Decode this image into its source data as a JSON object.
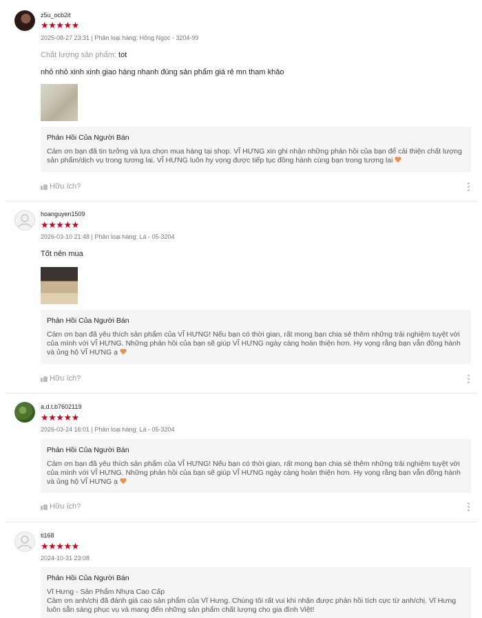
{
  "reviews": [
    {
      "username": "z5u_ocb2it",
      "stars": "★★★★★",
      "meta": "2025-08-27 23:31 | Phân loại hàng: Hồng Ngọc - 3204-99",
      "quality_label": "Chất lượng sản phẩm:",
      "quality_value": "tot",
      "comment": "nhỏ nhỏ xinh xinh giao hàng nhanh đúng sản phẩm giá rẻ mn tham khảo",
      "reply_title": "Phản Hồi Của Người Bán",
      "reply_text": "Cảm ơn bạn đã tin tưởng và lựa chọn mua hàng tại shop. VĨ HƯNG xin ghi nhận những phản hồi của bạn để cải thiện chất lượng sản phẩm/dịch vụ trong tương lai. VĨ HƯNG luôn hy vọng được tiếp tục đồng hành cùng bạn trong tương lai",
      "helpful": "Hữu ích?"
    },
    {
      "username": "hoanguyen1509",
      "stars": "★★★★★",
      "meta": "2026-03-10 21:48 | Phân loại hàng: Lá - 05-3204",
      "comment": "Tốt nên mua",
      "reply_title": "Phản Hồi Của Người Bán",
      "reply_text": "Cảm ơn bạn đã yêu thích sản phẩm của VĨ HƯNG! Nếu bạn có thời gian, rất mong bạn chia sẻ thêm những trải nghiệm tuyệt vời của mình với VĨ HƯNG. Những phản hồi của bạn sẽ giúp VĨ HƯNG ngày càng hoàn thiện hơn. Hy vọng rằng bạn vẫn đồng hành và ủng hộ VĨ HƯNG ạ",
      "helpful": "Hữu ích?"
    },
    {
      "username": "a.d.t.b7602119",
      "stars": "★★★★★",
      "meta": "2026-03-24 16:01 | Phân loại hàng: Lá - 05-3204",
      "reply_title": "Phản Hồi Của Người Bán",
      "reply_text": "Cảm ơn bạn đã yêu thích sản phẩm của VĨ HƯNG! Nếu bạn có thời gian, rất mong bạn chia sẻ thêm những trải nghiệm tuyệt vời của mình với VĨ HƯNG. Những phản hồi của bạn sẽ giúp VĨ HƯNG ngày càng hoàn thiện hơn. Hy vọng rằng bạn vẫn đồng hành và ủng hộ VĨ HƯNG ạ",
      "helpful": "Hữu ích?"
    },
    {
      "username": "ti168",
      "stars": "★★★★★",
      "meta": "2024-10-31 23:08",
      "reply_title": "Phản Hồi Của Người Bán",
      "reply_line1": "Vĩ Hưng - Sản Phẩm Nhựa Cao Cấp",
      "reply_text": "Cảm ơn anh/chị đã đánh giá cao sản phẩm của Vĩ Hưng. Chúng tôi rất vui khi nhận được phản hồi tích cực từ anh/chị. Vĩ Hưng luôn sẵn sàng phục vụ và mang đến những sản phẩm chất lượng cho gia đình Việt!"
    }
  ]
}
